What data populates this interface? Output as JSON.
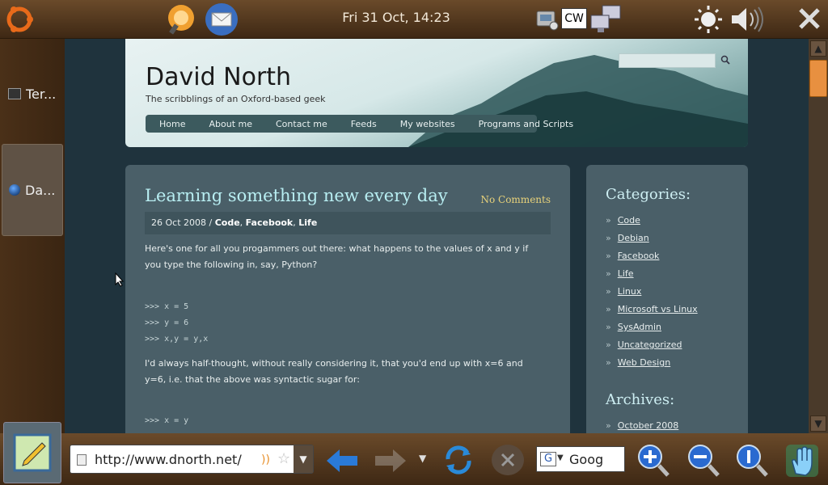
{
  "topbar": {
    "clock": "Fri 31 Oct, 14:23",
    "icons": [
      "ubuntu-menu-icon",
      "search-app-icon",
      "mail-app-icon",
      "connection-icon",
      "cw-keyboard-icon",
      "network-icon",
      "brightness-icon",
      "volume-icon",
      "close-icon"
    ]
  },
  "tasks": [
    {
      "label": "Ter...",
      "icon": "terminal-icon"
    },
    {
      "label": "Da...",
      "icon": "browser-icon"
    }
  ],
  "site": {
    "title": "David North",
    "tagline": "The scribblings of an Oxford-based geek",
    "nav": [
      "Home",
      "About me",
      "Contact me",
      "Feeds",
      "My websites",
      "Programs and Scripts"
    ]
  },
  "post": {
    "title": "Learning something new every day",
    "comments": "No Comments",
    "date": "26 Oct 2008 / ",
    "tags": [
      "Code",
      "Facebook",
      "Life"
    ],
    "para1": "Here's one for all you progammers out there: what happens to the values of x and y if you type the following in, say, Python?",
    "code1": [
      ">>> x = 5",
      ">>> y = 6",
      ">>> x,y = y,x"
    ],
    "para2": "I'd always half-thought, without really considering it, that you'd end up with x=6 and y=6, i.e. that the above was syntactic sugar for:",
    "code2": [
      ">>> x = y"
    ]
  },
  "sidebar": {
    "categories_title": "Categories:",
    "categories": [
      "Code",
      "Debian",
      "Facebook",
      "Life",
      "Linux",
      "Microsoft vs Linux",
      "SysAdmin",
      "Uncategorized",
      "Web Design"
    ],
    "archives_title": "Archives:",
    "archives": [
      "October 2008"
    ]
  },
  "bottombar": {
    "url": "http://www.dnorth.net/",
    "search_text": "Goog"
  }
}
